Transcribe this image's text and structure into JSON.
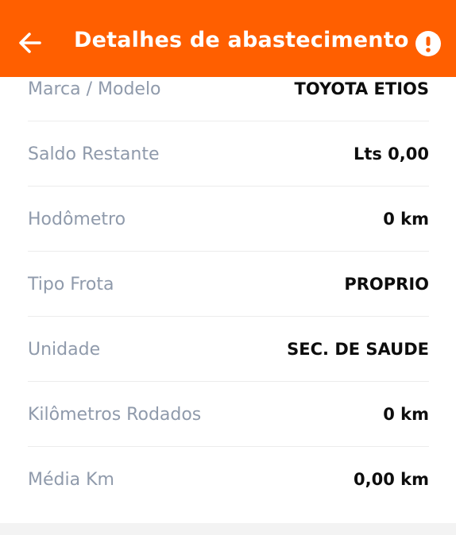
{
  "header": {
    "title": "Detalhes de abastecimento",
    "back_icon": "arrow-left-icon",
    "alert_icon": "exclamation-circle-icon",
    "background_color": "#ff5f00"
  },
  "details": [
    {
      "label": "Marca / Modelo",
      "value": "TOYOTA ETIOS"
    },
    {
      "label": "Saldo Restante",
      "value": "Lts 0,00"
    },
    {
      "label": "Hodômetro",
      "value": "0 km"
    },
    {
      "label": "Tipo Frota",
      "value": "PROPRIO"
    },
    {
      "label": "Unidade",
      "value": "SEC. DE SAUDE"
    },
    {
      "label": "Kilômetros Rodados",
      "value": "0 km"
    },
    {
      "label": "Média Km",
      "value": "0,00 km"
    }
  ]
}
